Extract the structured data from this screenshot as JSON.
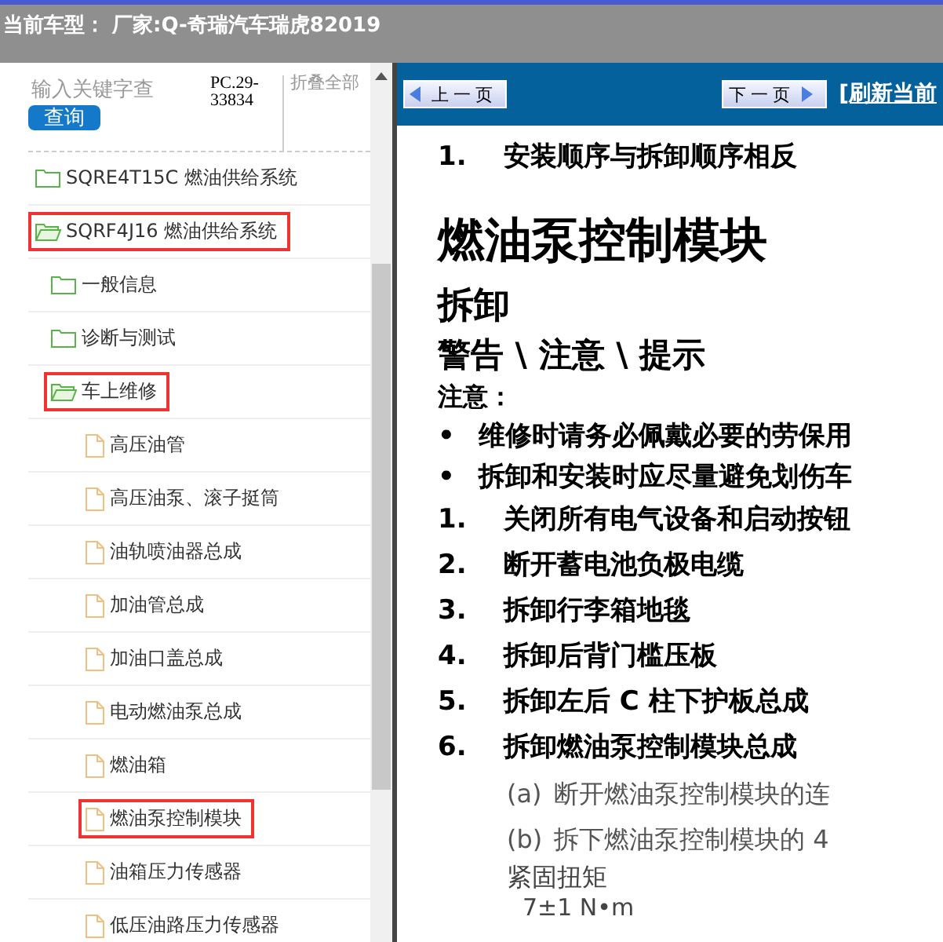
{
  "header": {
    "text": "当前车型： 厂家:Q-奇瑞汽车瑞虎82019"
  },
  "sidebar": {
    "search": {
      "placeholder": "输入关键字查"
    },
    "search_button": "查询",
    "code": "PC.29-33834",
    "collapse_all": "折叠全部",
    "tree": [
      {
        "label": "SQRE4T15C 燃油供给系统",
        "kind": "folder",
        "expanded": false,
        "highlighted": false
      },
      {
        "label": "SQRF4J16 燃油供给系统",
        "kind": "folder",
        "expanded": true,
        "highlighted": true,
        "children": [
          {
            "label": "一般信息",
            "kind": "folder",
            "expanded": false,
            "highlighted": false
          },
          {
            "label": "诊断与测试",
            "kind": "folder",
            "expanded": false,
            "highlighted": false
          },
          {
            "label": "车上维修",
            "kind": "folder",
            "expanded": true,
            "highlighted": true,
            "children": [
              {
                "label": "高压油管",
                "kind": "document",
                "highlighted": false
              },
              {
                "label": "高压油泵、滚子挺筒",
                "kind": "document",
                "highlighted": false
              },
              {
                "label": "油轨喷油器总成",
                "kind": "document",
                "highlighted": false
              },
              {
                "label": "加油管总成",
                "kind": "document",
                "highlighted": false
              },
              {
                "label": "加油口盖总成",
                "kind": "document",
                "highlighted": false
              },
              {
                "label": "电动燃油泵总成",
                "kind": "document",
                "highlighted": false
              },
              {
                "label": "燃油箱",
                "kind": "document",
                "highlighted": false
              },
              {
                "label": "燃油泵控制模块",
                "kind": "document",
                "highlighted": true
              },
              {
                "label": "油箱压力传感器",
                "kind": "document",
                "highlighted": false
              },
              {
                "label": "低压油路压力传感器",
                "kind": "document",
                "highlighted": false
              }
            ]
          }
        ]
      }
    ]
  },
  "toolbar": {
    "prev": "上 一 页",
    "next": "下 一 页",
    "refresh": "[刷新当前"
  },
  "document": [
    {
      "kind": "step",
      "num": "1.",
      "text": "安装顺序与拆卸顺序相反"
    },
    {
      "kind": "title",
      "text": "燃油泵控制模块"
    },
    {
      "kind": "heading",
      "text": "拆卸"
    },
    {
      "kind": "subheading",
      "text": "警告 \\ 注意 \\ 提示"
    },
    {
      "kind": "label",
      "text": "注意："
    },
    {
      "kind": "bullet",
      "num": "•",
      "text": "维修时请务必佩戴必要的劳保用"
    },
    {
      "kind": "bullet",
      "num": "•",
      "text": "拆卸和安装时应尽量避免划伤车"
    },
    {
      "kind": "step",
      "num": "1.",
      "text": "关闭所有电气设备和启动按钮"
    },
    {
      "kind": "step",
      "num": "2.",
      "text": "断开蓄电池负极电缆"
    },
    {
      "kind": "step",
      "num": "3.",
      "text": "拆卸行李箱地毯"
    },
    {
      "kind": "step",
      "num": "4.",
      "text": "拆卸后背门槛压板"
    },
    {
      "kind": "step",
      "num": "5.",
      "text": "拆卸左后 C 柱下护板总成"
    },
    {
      "kind": "step",
      "num": "6.",
      "text": "拆卸燃油泵控制模块总成"
    },
    {
      "kind": "substep",
      "num": "(a)",
      "text": "断开燃油泵控制模块的连"
    },
    {
      "kind": "substep",
      "num": "(b)",
      "text": "拆下燃油泵控制模块的 4"
    },
    {
      "kind": "spec",
      "text": "紧固扭矩"
    },
    {
      "kind": "spec_value",
      "text": "7±1 N•m"
    }
  ]
}
